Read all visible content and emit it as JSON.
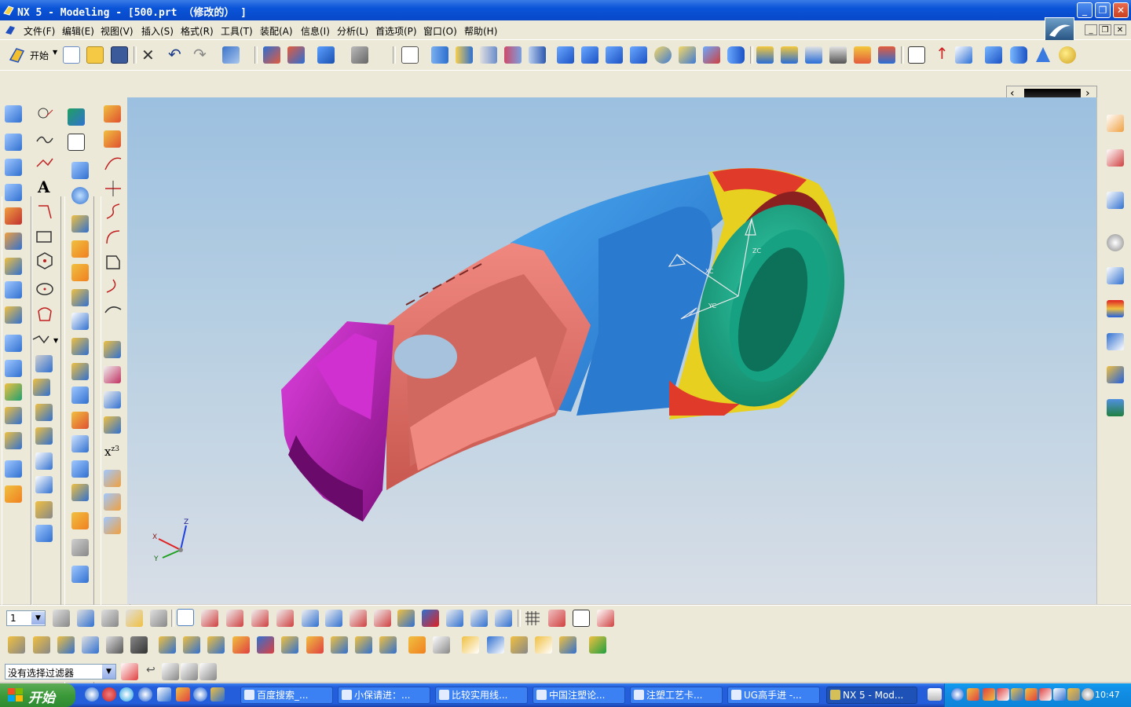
{
  "window": {
    "title": "NX 5 - Modeling - [500.prt （修改的） ]"
  },
  "menubar": {
    "items": [
      "文件(F)",
      "编辑(E)",
      "视图(V)",
      "插入(S)",
      "格式(R)",
      "工具(T)",
      "装配(A)",
      "信息(I)",
      "分析(L)",
      "首选项(P)",
      "窗口(O)",
      "帮助(H)"
    ]
  },
  "standard_toolbar": {
    "start_label": "开始"
  },
  "layer_toolbar": {
    "work_layer_value": "1"
  },
  "status_bar": {
    "selection_filter": "没有选择过滤器"
  },
  "viewport": {
    "triad_labels": {
      "x": "X",
      "y": "Y",
      "z": "Z"
    },
    "csys_labels": [
      "XC",
      "YC",
      "ZC"
    ],
    "background_top": "#9cc0e0",
    "background_bottom": "#d8dee6",
    "part_colors": {
      "grip": "#e8736c",
      "clamp": "#cc33cc",
      "body": "#3a8fd8",
      "ring": "#1aa58a",
      "accent_red": "#e03a2a",
      "accent_yellow": "#e0d020"
    }
  },
  "taskbar": {
    "start_label": "开始",
    "tasks": [
      {
        "label": "百度搜索_...",
        "active": false
      },
      {
        "label": "小保请进：...",
        "active": false
      },
      {
        "label": "比较实用线...",
        "active": false
      },
      {
        "label": "中国注塑论...",
        "active": false
      },
      {
        "label": "注塑工艺卡...",
        "active": false
      },
      {
        "label": "UG高手进 -...",
        "active": false
      },
      {
        "label": "NX 5 - Mod...",
        "active": true
      }
    ],
    "clock": "10:47"
  },
  "icons": {
    "title": "nx-logo-icon",
    "minimize": "minimize-icon",
    "maximize": "maximize-icon",
    "close": "close-icon"
  }
}
